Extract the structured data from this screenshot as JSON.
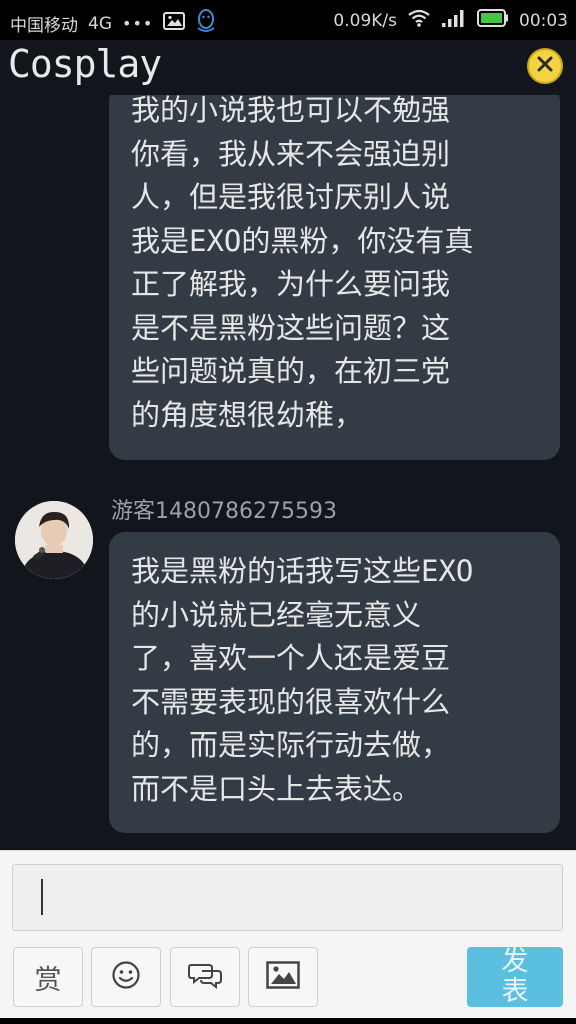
{
  "status_bar": {
    "carrier": "中国移动",
    "network": "4G",
    "dots": "•••",
    "speed": "0.09K/s",
    "time": "00:03"
  },
  "header": {
    "title": "Cosplay"
  },
  "messages": [
    {
      "text": "我的小说我也可以不勉强\n你看，我从来不会强迫别\n人，但是我很讨厌别人说\n我是EXO的黑粉，你没有真\n正了解我，为什么要问我\n是不是黑粉这些问题？这\n些问题说真的，在初三党\n的角度想很幼稚，"
    },
    {
      "username": "游客1480786275593",
      "text": "我是黑粉的话我写这些EXO\n的小说就已经毫无意义\n了，喜欢一个人还是爱豆\n不需要表现的很喜欢什么\n的，而是实际行动去做，\n而不是口头上去表达。"
    }
  ],
  "composer": {
    "value": "",
    "reward_label": "赏",
    "send_label": "发表"
  },
  "colors": {
    "bubble": "#333c45",
    "background": "#12161c",
    "send_button": "#5bbfe0",
    "close_button": "#f3d440"
  }
}
